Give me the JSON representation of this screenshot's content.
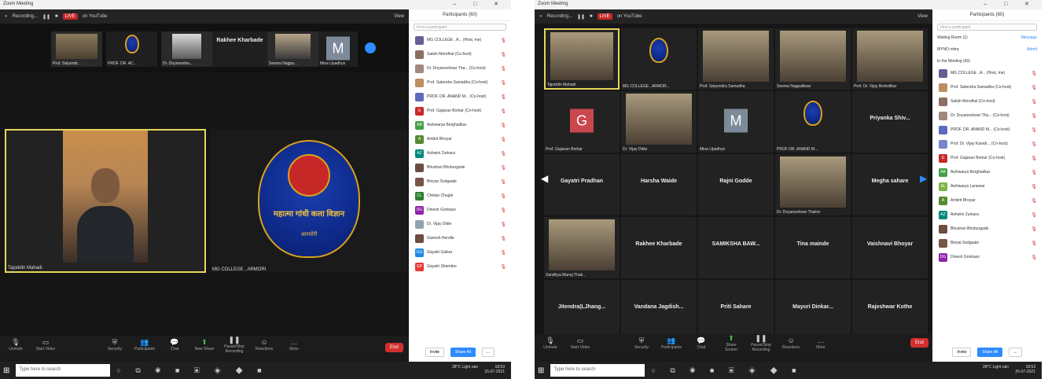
{
  "window_a": {
    "title": "Zoom Meeting",
    "controls": "– □ ✕",
    "recording_label": "Recording...",
    "live_label": "LIVE",
    "live_on": "on YouTube",
    "view_label": "View",
    "top_strip": [
      {
        "name": "Prof. Satyendr...",
        "kind": "photo"
      },
      {
        "name": "PROF. DR. AC...",
        "kind": "logo"
      },
      {
        "name": "Dr. Dnyaneshw...",
        "kind": "photo"
      },
      {
        "name": "Rakhee Kharbade",
        "kind": "text"
      },
      {
        "name": "Seema Nagpa...",
        "kind": "photo"
      },
      {
        "name": "Mina Upadhye",
        "kind": "avatar",
        "letter": "M",
        "color": "#7d8a9a"
      }
    ],
    "speaker_name": "Tajoddin Mahadi",
    "emblem_name": "MG COLLEGE , ARMORI",
    "emblem_text": "महात्मा गांधी कला विज्ञान",
    "emblem_sub": "आरमोरी",
    "panel": {
      "title": "Participants (60)",
      "search_placeholder": "Find a participant",
      "participants": [
        {
          "name": "MG COLLEGE , A... (Host, me)",
          "initials": "",
          "color": "#6b5b95"
        },
        {
          "name": "Satish Mendhal (Co-host)",
          "initials": "",
          "color": "#8d6e63"
        },
        {
          "name": "Dr. Dnyaneshwar Tha... (Co-host)",
          "initials": "",
          "color": "#a1887f"
        },
        {
          "name": "Prof. Satendra Samadha (Co-host)",
          "initials": "",
          "color": "#bc8f5f"
        },
        {
          "name": "PROF. DR. ANAND M... (Co-host)",
          "initials": "",
          "color": "#5c6bc0"
        },
        {
          "name": "Prof. Gajanan Borkar (Co-host)",
          "initials": "G",
          "color": "#c62828"
        },
        {
          "name": "Aishwarya Borghadkar",
          "initials": "AB",
          "color": "#43a047"
        },
        {
          "name": "Ambrit Bhoyar",
          "initials": "A",
          "color": "#558b2f"
        },
        {
          "name": "Ashwini Zurkara",
          "initials": "AZ",
          "color": "#00897b"
        },
        {
          "name": "Bhushan Bhoburgade",
          "initials": "",
          "color": "#6d4c41"
        },
        {
          "name": "Binyan Sodgaale",
          "initials": "",
          "color": "#795548"
        },
        {
          "name": "Chetan Chugle",
          "initials": "CL",
          "color": "#2e7d32"
        },
        {
          "name": "Dinesh Gonkaso",
          "initials": "DG",
          "color": "#8e24aa"
        },
        {
          "name": "Dr. Vijay Dikte",
          "initials": "",
          "color": "#90a4ae"
        },
        {
          "name": "Ganesh Hendle",
          "initials": "",
          "color": "#6d4c41"
        },
        {
          "name": "Gayatri Gaikar",
          "initials": "GG",
          "color": "#1e88e5"
        },
        {
          "name": "Gayatri Shembre",
          "initials": "GP",
          "color": "#e53935"
        }
      ],
      "invite_label": "Invite",
      "share_label": "Share All",
      "more_label": "..."
    },
    "toolbar": [
      "Unmute",
      "Start Video",
      "Security",
      "Participants",
      "Chat",
      "New Share",
      "Pause/Stop Recording",
      "Reactions",
      "More"
    ],
    "end_label": "End",
    "taskbar_search": "Type here to search",
    "tray": "28°C Light rain",
    "clock": "18:53",
    "date": "25-07-2021"
  },
  "window_b": {
    "title": "Zoom Meeting",
    "controls": "– □ ✕",
    "recording_label": "Recording...",
    "live_label": "LIVE",
    "live_on": "on YouTube",
    "view_label": "View",
    "grid_rows": [
      [
        {
          "name": "Tajoddin Mahadi",
          "kind": "photo"
        },
        {
          "name": "MG COLLEGE , ARMOR...",
          "kind": "logo"
        },
        {
          "name": "Prof. Satyendra Samadha",
          "kind": "photo"
        },
        {
          "name": "Seema Nagpalliwar",
          "kind": "photo"
        },
        {
          "name": "Prof. Dr. Vijay Borkoltkar",
          "kind": "photo"
        }
      ],
      [
        {
          "name": "Prof. Gajanan Borkar",
          "kind": "avatar",
          "letter": "G",
          "color": "#c9484e"
        },
        {
          "name": "Dr. Vijay Dikte",
          "kind": "photo"
        },
        {
          "name": "Mina Upadhye",
          "kind": "avatar",
          "letter": "M",
          "color": "#7d8a9a"
        },
        {
          "name": "PROF DR. ANAND M...",
          "kind": "logo"
        },
        {
          "name": "Priyanka Shiv...",
          "kind": "text"
        }
      ],
      [
        {
          "name": "Gayatri Pradhan",
          "kind": "text"
        },
        {
          "name": "Harsha Waide",
          "kind": "text"
        },
        {
          "name": "Rajni Godde",
          "kind": "text"
        },
        {
          "name": "Dr. Dnyaneshwar Thakre",
          "kind": "photo"
        },
        {
          "name": "Megha sahare",
          "kind": "text"
        }
      ],
      [
        {
          "name": "Sandhya Manoj Thak...",
          "kind": "photo"
        },
        {
          "name": "Rakhee Kharbade",
          "kind": "text"
        },
        {
          "name": "SAMIKSHA BAW...",
          "kind": "text"
        },
        {
          "name": "Tina mainde",
          "kind": "text"
        },
        {
          "name": "Vaishnavi Bhoyar",
          "kind": "text"
        }
      ],
      [
        {
          "name": "Jitendra(LJhang...",
          "kind": "text"
        },
        {
          "name": "Vandana Jagdish...",
          "kind": "text"
        },
        {
          "name": "Priti Sahare",
          "kind": "text"
        },
        {
          "name": "Mayuri Dinkar...",
          "kind": "text"
        },
        {
          "name": "Rajeshwar Kothe",
          "kind": "text"
        }
      ]
    ],
    "panel": {
      "title": "Participants (60)",
      "search_placeholder": "Find a participant",
      "waiting_label": "Waiting Room (1)",
      "message_label": "Message",
      "waiting_name": "MYNO mitra",
      "admit_label": "Admit",
      "in_meeting_label": "In the Meeting (60)",
      "participants": [
        {
          "name": "MG COLLEGE , A... (Host, me)",
          "initials": "",
          "color": "#6b5b95"
        },
        {
          "name": "Prof. Satendra Samadha (Co-host)",
          "initials": "",
          "color": "#bc8f5f"
        },
        {
          "name": "Satish Mendhal (Co-host)",
          "initials": "",
          "color": "#8d6e63"
        },
        {
          "name": "Dr. Dnyaneshwar Tha... (Co-host)",
          "initials": "",
          "color": "#a1887f"
        },
        {
          "name": "PROF. DR. ANAND M... (Co-host)",
          "initials": "",
          "color": "#5c6bc0"
        },
        {
          "name": "Prof. Dr. Vijay Karedi... (Co-host)",
          "initials": "",
          "color": "#7986cb"
        },
        {
          "name": "Prof. Gajanan Borkar (Co-host)",
          "initials": "G",
          "color": "#c62828"
        },
        {
          "name": "Aishwarya Borghadkar",
          "initials": "AB",
          "color": "#43a047"
        },
        {
          "name": "Aishwarya Lanewar",
          "initials": "AL",
          "color": "#7cb342"
        },
        {
          "name": "Ambrit Bhoyar",
          "initials": "A",
          "color": "#558b2f"
        },
        {
          "name": "Ashwini Zurkara",
          "initials": "AZ",
          "color": "#00897b"
        },
        {
          "name": "Bhushan Bhoburgade",
          "initials": "",
          "color": "#6d4c41"
        },
        {
          "name": "Binyal Sodgaale",
          "initials": "",
          "color": "#795548"
        },
        {
          "name": "Dinesh Gonkaso",
          "initials": "DG",
          "color": "#8e24aa"
        }
      ],
      "invite_label": "Invite",
      "share_label": "Share All",
      "more_label": "..."
    },
    "toolbar": [
      "Unmute",
      "Start Video",
      "Security",
      "Participants",
      "Chat",
      "Share Screen",
      "Pause/Stop Recording",
      "Reactions",
      "More"
    ],
    "end_label": "End",
    "taskbar_search": "Type here to search",
    "tray": "28°C Light rain",
    "clock": "18:53",
    "date": "25-07-2021"
  }
}
